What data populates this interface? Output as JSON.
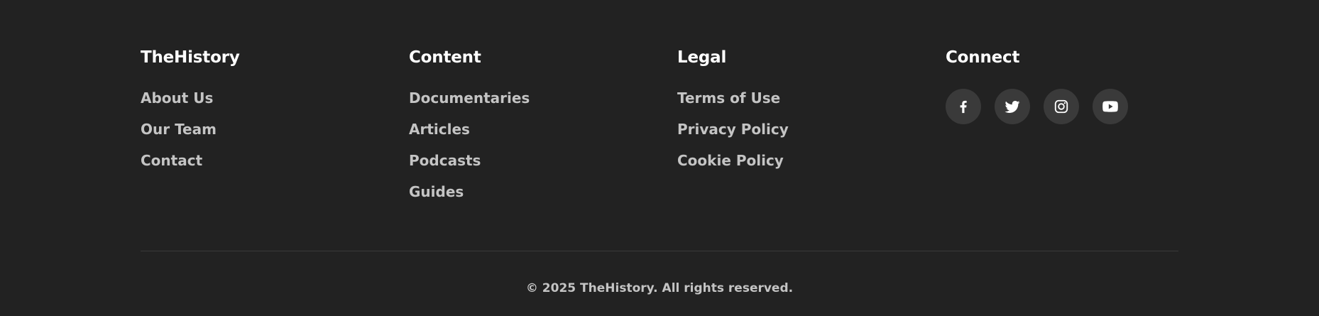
{
  "colors": {
    "background": "#222222",
    "heading": "#ffffff",
    "link": "#c4c4c4",
    "social_circle": "#3a3a3a",
    "divider": "#3a3a3a"
  },
  "footer": {
    "columns": [
      {
        "title": "TheHistory",
        "links": [
          "About Us",
          "Our Team",
          "Contact"
        ]
      },
      {
        "title": "Content",
        "links": [
          "Documentaries",
          "Articles",
          "Podcasts",
          "Guides"
        ]
      },
      {
        "title": "Legal",
        "links": [
          "Terms of Use",
          "Privacy Policy",
          "Cookie Policy"
        ]
      }
    ],
    "connect": {
      "title": "Connect",
      "socials": [
        {
          "icon": "facebook-icon"
        },
        {
          "icon": "twitter-icon"
        },
        {
          "icon": "instagram-icon"
        },
        {
          "icon": "youtube-icon"
        }
      ]
    },
    "copyright": "© 2025 TheHistory. All rights reserved."
  }
}
